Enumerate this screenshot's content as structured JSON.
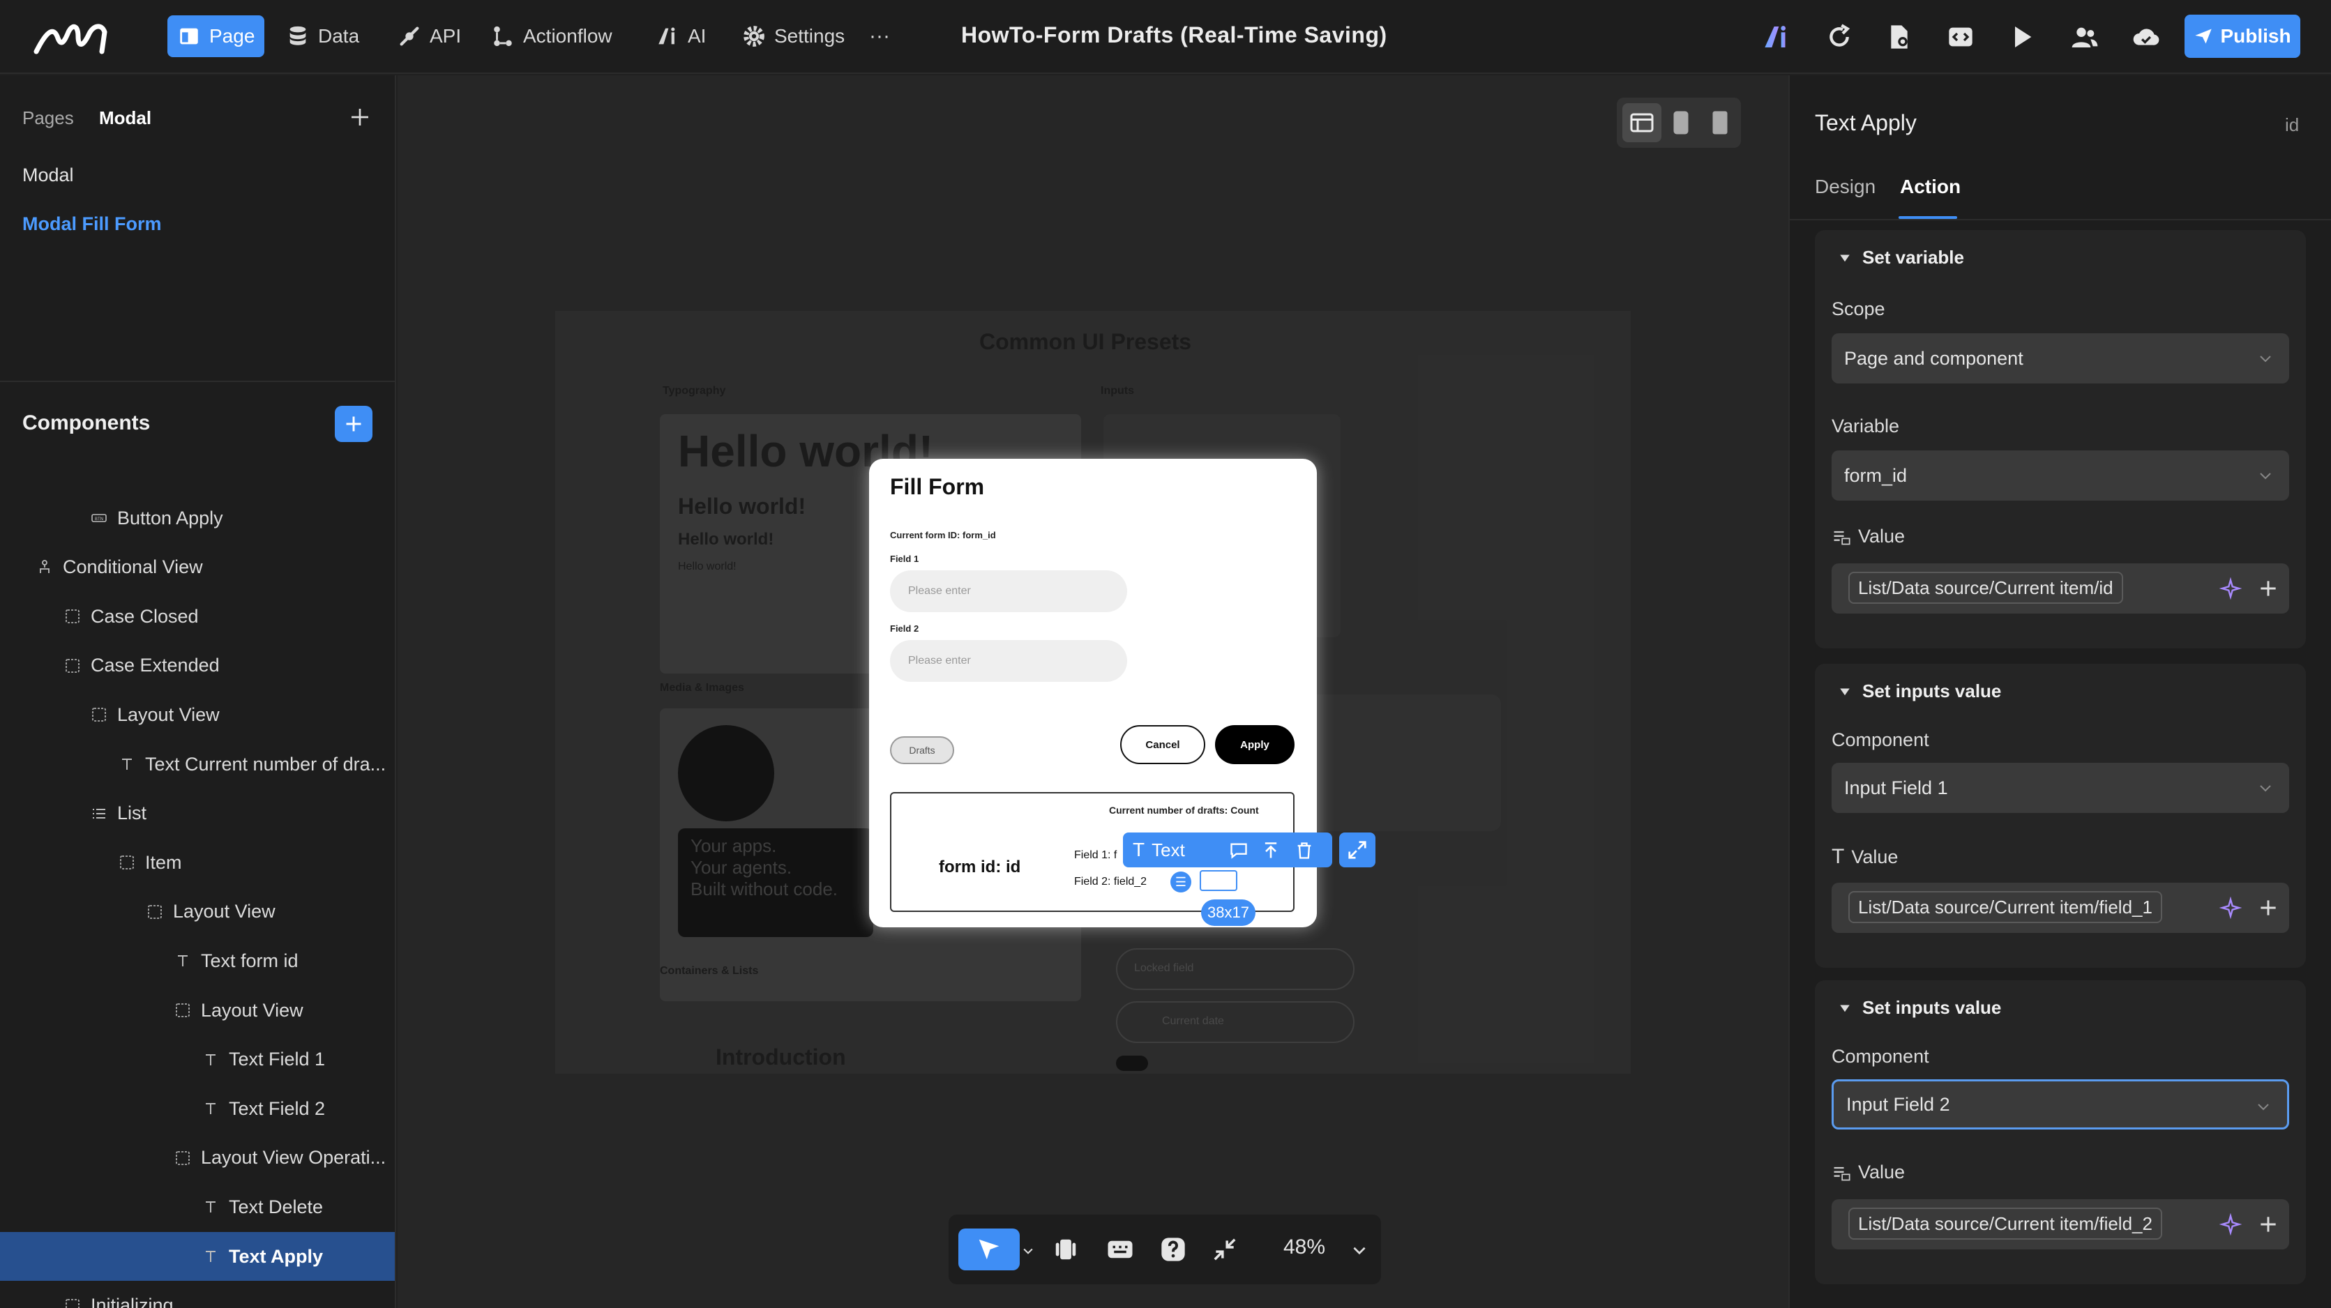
{
  "app": {
    "title": "HowTo-Form Drafts (Real-Time Saving)",
    "accent": "#3f8ef5",
    "nav": [
      {
        "label": "Page",
        "icon": "page-icon",
        "active": true
      },
      {
        "label": "Data",
        "icon": "database-icon"
      },
      {
        "label": "API",
        "icon": "api-icon"
      },
      {
        "label": "Actionflow",
        "icon": "actionflow-icon"
      },
      {
        "label": "AI",
        "icon": "ai-icon"
      },
      {
        "label": "Settings",
        "icon": "gear-icon"
      }
    ],
    "more": "···",
    "publish": "Publish"
  },
  "left": {
    "tabs": [
      "Pages",
      "Modal"
    ],
    "pages": [
      "Modal",
      "Modal Fill Form"
    ],
    "components_title": "Components",
    "tree": [
      {
        "label": "Button Apply",
        "icon": "button"
      },
      {
        "label": "Conditional View",
        "icon": "conditional"
      },
      {
        "label": "Case Closed",
        "icon": "view"
      },
      {
        "label": "Case Extended",
        "icon": "view"
      },
      {
        "label": "Layout View",
        "icon": "view"
      },
      {
        "label": "Text Current number of dra...",
        "icon": "text"
      },
      {
        "label": "List",
        "icon": "list"
      },
      {
        "label": "Item",
        "icon": "view"
      },
      {
        "label": "Layout View",
        "icon": "view"
      },
      {
        "label": "Text form id",
        "icon": "text"
      },
      {
        "label": "Layout View",
        "icon": "view"
      },
      {
        "label": "Text Field 1",
        "icon": "text"
      },
      {
        "label": "Text Field 2",
        "icon": "text"
      },
      {
        "label": "Layout View Operati...",
        "icon": "view"
      },
      {
        "label": "Text Delete",
        "icon": "text"
      },
      {
        "label": "Text Apply",
        "icon": "text",
        "selected": true
      },
      {
        "label": "Initializing",
        "icon": "view"
      }
    ]
  },
  "canvas": {
    "background_preset": {
      "title": "Common UI Presets",
      "typography": "Typography",
      "inputs": "Inputs",
      "hello_large": "Hello world!",
      "hello_mid": "Hello world!",
      "hello_small": "Hello world!",
      "hello_tiny": "Hello world!",
      "media": "Media & Images",
      "apps_text": "Your apps.\nYour agents.\nBuilt without code.",
      "containers": "Containers & Lists",
      "introduction": "Introduction",
      "locked_field": "Locked field",
      "current_date": "Current date"
    },
    "modal": {
      "title": "Fill Form",
      "form_id_label": "Current form ID: form_id",
      "field1_label": "Field 1",
      "field1_placeholder": "Please enter",
      "field2_label": "Field 2",
      "field2_placeholder": "Please enter",
      "drafts": "Drafts",
      "cancel": "Cancel",
      "apply": "Apply",
      "drafts_count": "Current number of drafts: Count",
      "form_id_text": "form id: id",
      "field1_text": "Field 1: f",
      "field2_text": "Field 2: field_2"
    },
    "selection": {
      "type_label": "Text",
      "size": "38x17"
    },
    "zoom": "48%"
  },
  "right": {
    "title": "Text Apply",
    "id_label": "id",
    "tabs": [
      "Design",
      "Action"
    ],
    "active_tab": "Action",
    "sections": [
      {
        "title": "Set variable",
        "scope_label": "Scope",
        "scope_value": "Page and component",
        "variable_label": "Variable",
        "variable_value": "form_id",
        "value_label": "Value",
        "value": "List/Data source/Current item/id"
      },
      {
        "title": "Set inputs value",
        "component_label": "Component",
        "component_value": "Input Field 1",
        "value_label": "Value",
        "value": "List/Data source/Current item/field_1"
      },
      {
        "title": "Set inputs value",
        "component_label": "Component",
        "component_value": "Input Field 2",
        "value_label": "Value",
        "value": "List/Data source/Current item/field_2"
      }
    ]
  }
}
